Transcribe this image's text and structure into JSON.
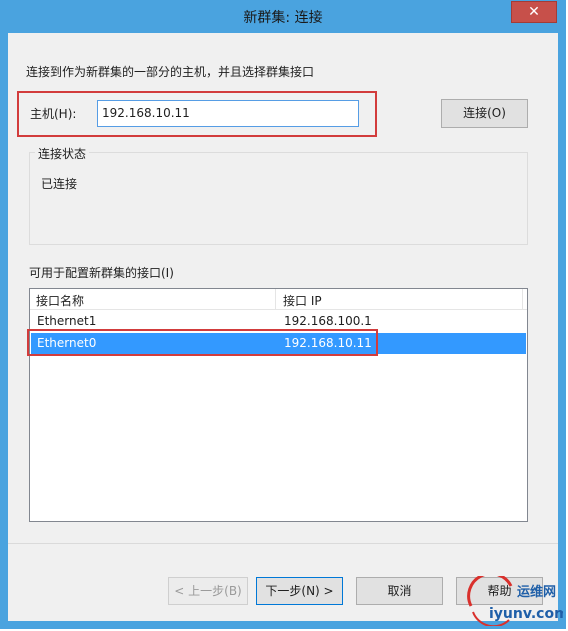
{
  "window": {
    "title": "新群集: 连接",
    "close_glyph": "✕"
  },
  "description": "连接到作为新群集的一部分的主机，并且选择群集接口",
  "host": {
    "label": "主机(H):",
    "value": "192.168.10.11",
    "connect_button": "连接(O)"
  },
  "status": {
    "group_label": "连接状态",
    "text": "已连接"
  },
  "interfaces": {
    "label": "可用于配置新群集的接口(I)",
    "columns": [
      "接口名称",
      "接口 IP"
    ],
    "rows": [
      {
        "name": "Ethernet1",
        "ip": "192.168.100.1",
        "selected": false
      },
      {
        "name": "Ethernet0",
        "ip": "192.168.10.11",
        "selected": true
      }
    ]
  },
  "buttons": {
    "back": "< 上一步(B)",
    "next": "下一步(N) >",
    "cancel": "取消",
    "help": "帮助"
  },
  "watermark": {
    "text_top": "运维网",
    "text_bottom": "iyunv.com"
  },
  "colors": {
    "titlebar": "#4aa3df",
    "selection": "#3399ff",
    "highlight_box": "#d23c3c"
  }
}
